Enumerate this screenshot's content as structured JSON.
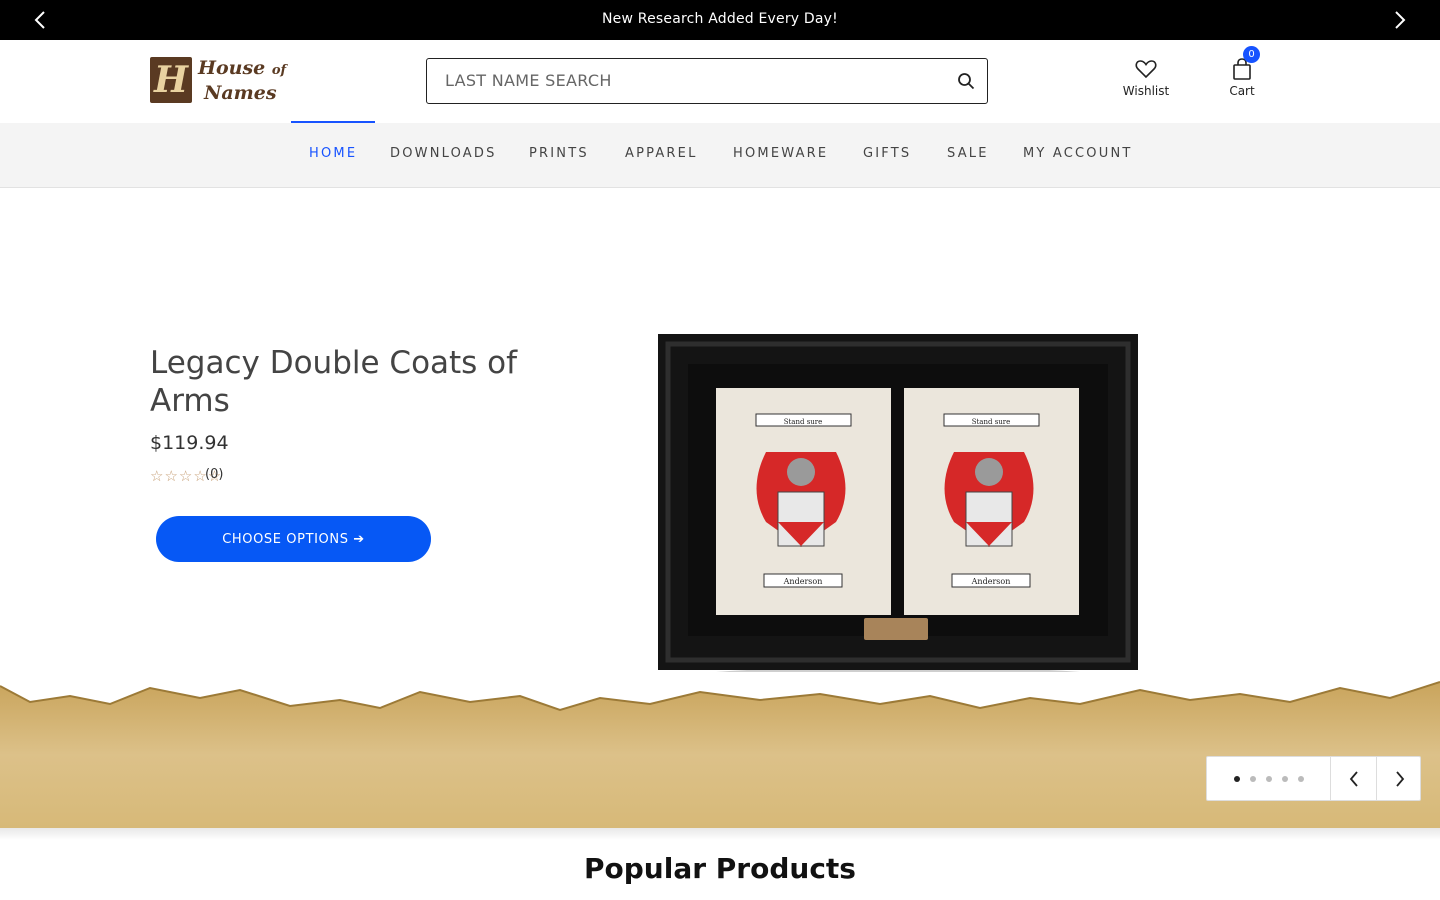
{
  "announcement": {
    "message": "New Research Added Every Day!"
  },
  "logo": {
    "mark": "H",
    "line1": "House",
    "line1_small": "of",
    "line2": "Names"
  },
  "search": {
    "placeholder": "LAST NAME SEARCH",
    "value": ""
  },
  "header": {
    "wishlist_label": "Wishlist",
    "cart_label": "Cart",
    "cart_count": "0"
  },
  "nav": {
    "items": [
      {
        "label": "HOME",
        "active": true
      },
      {
        "label": "DOWNLOADS"
      },
      {
        "label": "PRINTS"
      },
      {
        "label": "APPAREL"
      },
      {
        "label": "HOMEWARE"
      },
      {
        "label": "GIFTS"
      },
      {
        "label": "SALE"
      },
      {
        "label": "MY ACCOUNT"
      }
    ]
  },
  "hero": {
    "title": "Legacy Double Coats of Arms",
    "price": "$119.94",
    "stars": "☆☆☆☆☆",
    "review_count": "(0)",
    "cta_label": "CHOOSE OPTIONS ➔",
    "frame": {
      "motto": "Stand sure",
      "surname": "Anderson"
    },
    "slide_count": 5,
    "active_slide": 1
  },
  "sections": {
    "popular_title": "Popular Products"
  },
  "colors": {
    "accent": "#1753ff",
    "cta": "#0658f5",
    "topbar": "#000000",
    "star": "#c8a27a"
  },
  "icons": [
    "chevron-left-icon",
    "chevron-right-icon",
    "search-icon",
    "heart-icon",
    "bag-icon"
  ]
}
